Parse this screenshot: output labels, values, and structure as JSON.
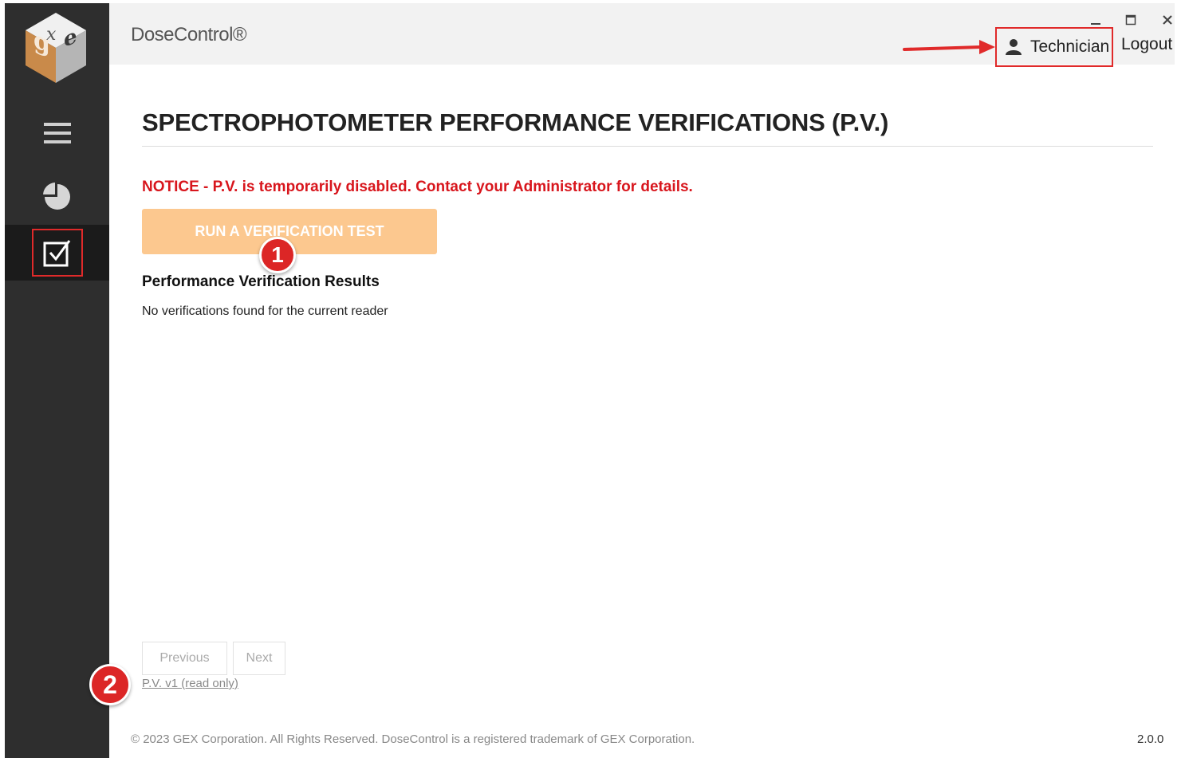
{
  "sidebar": {
    "logo_name": "gex-cube-logo",
    "items": [
      {
        "icon": "hamburger-menu-icon"
      },
      {
        "icon": "pie-chart-icon"
      },
      {
        "icon": "checkbox-icon",
        "active": true
      }
    ]
  },
  "header": {
    "app_title": "DoseControl®",
    "window_controls": {
      "minimize": "minimize-icon",
      "maximize": "maximize-icon",
      "close": "close-icon"
    },
    "user": {
      "icon": "user-icon",
      "name": "Technician"
    },
    "logout_label": "Logout"
  },
  "main": {
    "title": "SPECTROPHOTOMETER PERFORMANCE VERIFICATIONS (P.V.)",
    "notice": "NOTICE - P.V. is temporarily disabled. Contact your Administrator for details.",
    "run_button_label": "RUN A VERIFICATION TEST",
    "results_heading": "Performance Verification Results",
    "empty_message": "No verifications found for the current reader",
    "pager": {
      "previous_label": "Previous",
      "next_label": "Next"
    },
    "version_link": "P.V. v1 (read only)"
  },
  "annotations": {
    "badge_1": "1",
    "badge_2": "2"
  },
  "footer": {
    "copyright": "© 2023 GEX Corporation. All Rights Reserved. DoseControl is a registered trademark of GEX Corporation.",
    "version": "2.0.0"
  },
  "colors": {
    "sidebar_bg": "#2e2e2e",
    "active_nav_bg": "#1b1b1b",
    "accent_orange": "#fcc88f",
    "notice_red": "#d8161d",
    "highlight_red": "#e02a2a"
  }
}
